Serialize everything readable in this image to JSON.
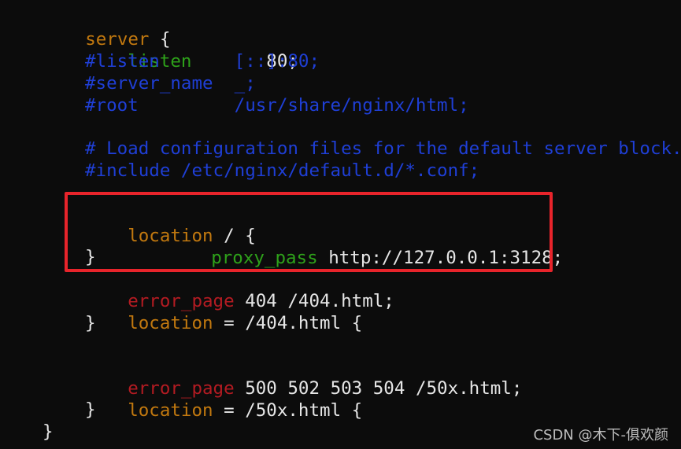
{
  "colors": {
    "background": "#0c0c0c",
    "keyword_orange": "#c1780f",
    "keyword_green": "#2ea11a",
    "keyword_red": "#b31b22",
    "comment_blue": "#1f3fd6",
    "text": "#e6e6e6",
    "highlight_box": "#e8242b"
  },
  "code": {
    "server_kw": "server",
    "server_open": " {",
    "listen_kw": "listen",
    "listen_val": "       80;",
    "c_listen": "#listen       [::]:80;",
    "c_server_name": "#server_name  _;",
    "c_root": "#root         /usr/share/nginx/html;",
    "c_load": "# Load configuration files for the default server block.",
    "c_include": "#include /etc/nginx/default.d/*.conf;",
    "loc1_kw": "location",
    "loc1_rest": " / {",
    "proxy_kw": "proxy_pass",
    "proxy_val": " http://127.0.0.1:3128;",
    "loc1_close": "}",
    "err1_kw": "error_page",
    "err1_rest": " 404 /404.html;",
    "loc2_kw": "location",
    "loc2_rest": " = /404.html {",
    "loc2_close": "}",
    "err2_kw": "error_page",
    "err2_rest": " 500 502 503 504 /50x.html;",
    "loc3_kw": "location",
    "loc3_rest": " = /50x.html {",
    "loc3_close": "}",
    "server_close": "}"
  },
  "watermark": "CSDN @木下-俱欢颜"
}
